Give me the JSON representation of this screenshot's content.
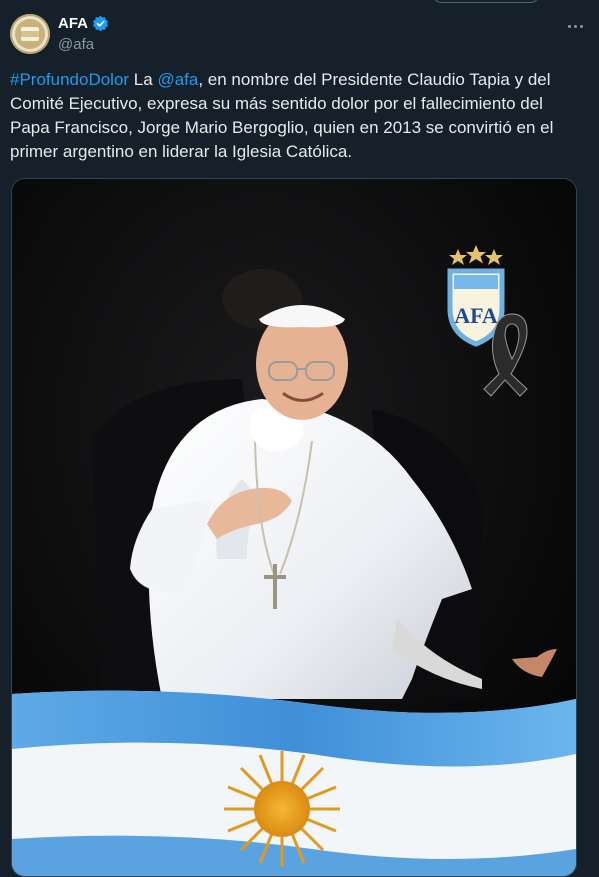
{
  "account": {
    "display_name": "AFA",
    "handle": "@afa",
    "verified": true,
    "avatar_icon": "afa-crest-icon"
  },
  "tweet": {
    "hashtag": "#ProfundoDolor",
    "text_part1": " La ",
    "mention": "@afa",
    "text_part2": ", en nombre del Presidente Claudio Tapia y del Comité Ejecutivo, expresa su más sentido dolor por el fallecimiento del Papa Francisco, Jorge Mario Bergoglio, quien en 2013 se convirtió en el primer argentino en liderar la Iglesia Católica."
  },
  "media": {
    "crest_letters": "AFA",
    "stars_count": 3
  },
  "colors": {
    "background": "#15202b",
    "link": "#1d9bf0",
    "secondary_text": "#8b98a5",
    "verified": "#1d9bf0"
  }
}
